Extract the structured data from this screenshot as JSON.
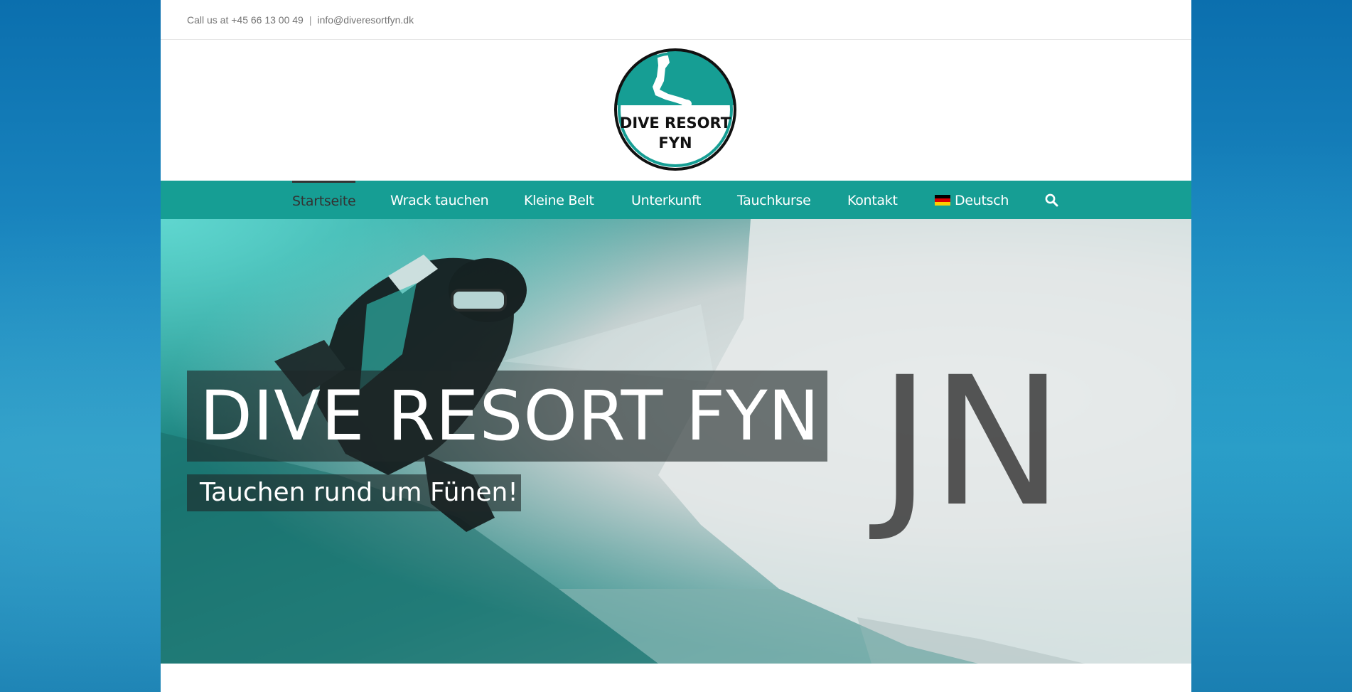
{
  "topbar": {
    "phone_text": "Call us at +45 66 13 00 49",
    "separator": "|",
    "email_text": "info@diveresortfyn.dk"
  },
  "logo": {
    "line1": "DIVE RESORT",
    "line2": "FYN",
    "colors": {
      "ring": "#111111",
      "top": "#169e94",
      "bottom": "#ffffff"
    }
  },
  "nav": {
    "items": [
      {
        "label": "Startseite",
        "active": true
      },
      {
        "label": "Wrack tauchen"
      },
      {
        "label": "Kleine Belt"
      },
      {
        "label": "Unterkunft"
      },
      {
        "label": "Tauchkurse"
      },
      {
        "label": "Kontakt"
      },
      {
        "label": "Deutsch",
        "icon": "german-flag-icon"
      }
    ],
    "search_icon": "search-icon",
    "background_color": "#169e94"
  },
  "hero": {
    "title": "DIVE RESORT FYN",
    "subtitle": "Tauchen rund um Fünen!",
    "hull_letters": "JN"
  }
}
